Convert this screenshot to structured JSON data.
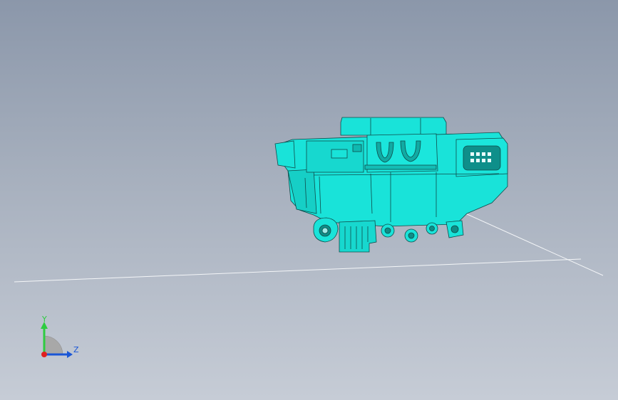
{
  "viewport": {
    "part_name": "",
    "part_color": "#19e3d9",
    "edge_color": "#0f4b4a",
    "background_top": "#8b97aa",
    "background_bottom": "#c6ccd6"
  },
  "triad": {
    "y_label": "Y",
    "z_label": "Z",
    "y_color": "#2ecc40",
    "z_color": "#1a56d6",
    "x_color": "#e02020"
  }
}
